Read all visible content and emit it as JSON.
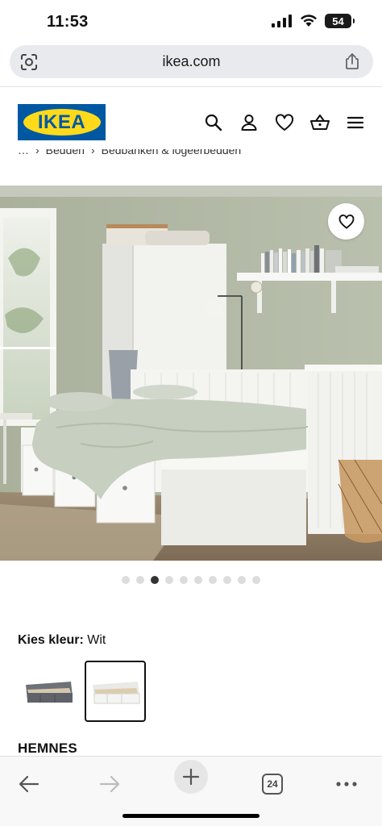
{
  "status": {
    "time": "11:53",
    "battery": "54"
  },
  "browser": {
    "url": "ikea.com",
    "tab_count": "24"
  },
  "brand": {
    "logo_text": "IKEA",
    "logo_blue": "#0058a3",
    "logo_yellow": "#ffda1a"
  },
  "breadcrumb": [
    "…",
    "Bedden",
    "Bedbanken & logeerbedden"
  ],
  "header": {
    "icons": [
      "search-icon",
      "account-icon",
      "heart-icon",
      "basket-icon",
      "menu-icon"
    ]
  },
  "carousel": {
    "total": 10,
    "active_index": 2
  },
  "color_picker": {
    "label": "Kies kleur:",
    "selected": "Wit",
    "options": [
      "grey",
      "white"
    ],
    "selected_index": 1
  },
  "product": {
    "name": "HEMNES"
  }
}
